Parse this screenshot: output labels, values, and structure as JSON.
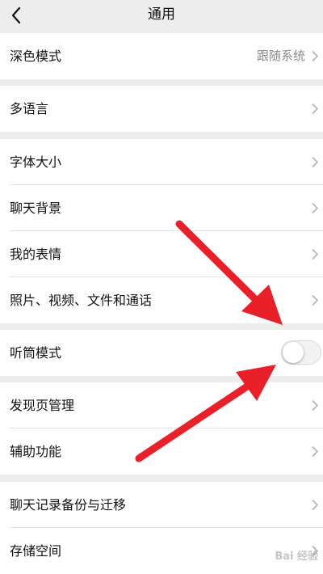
{
  "header": {
    "title": "通用",
    "back_icon": "chevron-left-icon"
  },
  "groups": [
    {
      "items": [
        {
          "label": "深色模式",
          "value": "跟随系统"
        }
      ]
    },
    {
      "items": [
        {
          "label": "多语言"
        }
      ]
    },
    {
      "items": [
        {
          "label": "字体大小"
        },
        {
          "label": "聊天背景"
        },
        {
          "label": "我的表情"
        },
        {
          "label": "照片、视频、文件和通话"
        }
      ]
    },
    {
      "items": [
        {
          "label": "听筒模式",
          "toggle": "off"
        }
      ]
    },
    {
      "items": [
        {
          "label": "发现页管理"
        },
        {
          "label": "辅助功能"
        }
      ]
    },
    {
      "items": [
        {
          "label": "聊天记录备份与迁移"
        },
        {
          "label": "存储空间"
        }
      ]
    }
  ],
  "annotation": {
    "arrow_color": "#e8202a",
    "arrow_count": 2
  },
  "watermark": "Bai 经验"
}
